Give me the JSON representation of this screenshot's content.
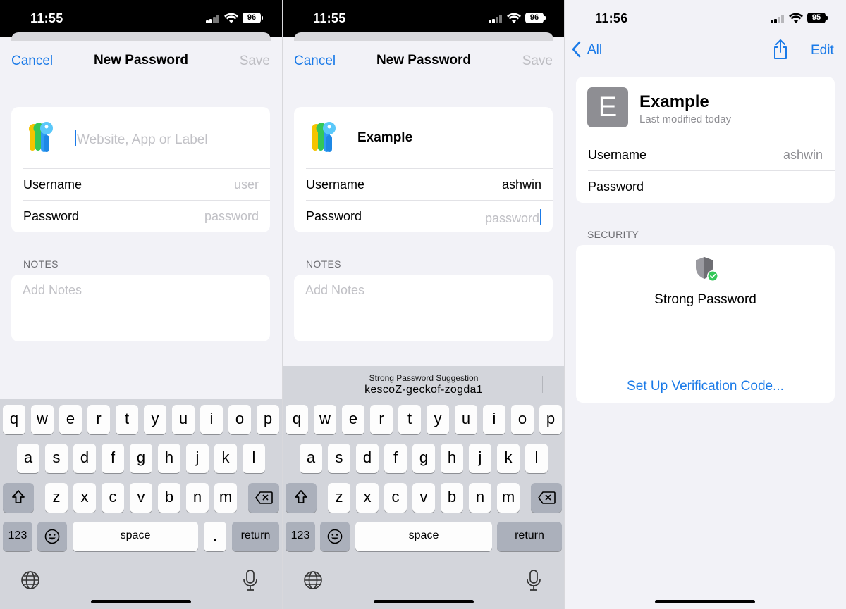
{
  "colors": {
    "accent": "#1a7ae8",
    "placeholder": "#c1c1c6",
    "keyboard_bg": "#d3d5db",
    "success": "#34c759"
  },
  "screens": [
    {
      "status": {
        "time": "11:55",
        "battery": "96"
      },
      "nav": {
        "cancel": "Cancel",
        "title": "New Password",
        "save": "Save"
      },
      "form": {
        "site_placeholder": "Website, App or Label",
        "site_value": "",
        "username_label": "Username",
        "username_value": "user",
        "password_label": "Password",
        "password_value": "password"
      },
      "notes": {
        "label": "NOTES",
        "placeholder": "Add Notes"
      },
      "keyboard": {
        "row1": [
          "q",
          "w",
          "e",
          "r",
          "t",
          "y",
          "u",
          "i",
          "o",
          "p"
        ],
        "row2": [
          "a",
          "s",
          "d",
          "f",
          "g",
          "h",
          "j",
          "k",
          "l"
        ],
        "row3": [
          "z",
          "x",
          "c",
          "v",
          "b",
          "n",
          "m"
        ],
        "numbers": "123",
        "space": "space",
        "period": ".",
        "return": "return"
      }
    },
    {
      "status": {
        "time": "11:55",
        "battery": "96"
      },
      "nav": {
        "cancel": "Cancel",
        "title": "New Password",
        "save": "Save"
      },
      "form": {
        "site_value": "Example",
        "username_label": "Username",
        "username_value": "ashwin",
        "password_label": "Password",
        "password_placeholder": "password"
      },
      "notes": {
        "label": "NOTES",
        "placeholder": "Add Notes"
      },
      "suggestion": {
        "title": "Strong Password Suggestion",
        "password": "kescoZ-geckof-zogda1"
      },
      "keyboard": {
        "row1": [
          "q",
          "w",
          "e",
          "r",
          "t",
          "y",
          "u",
          "i",
          "o",
          "p"
        ],
        "row2": [
          "a",
          "s",
          "d",
          "f",
          "g",
          "h",
          "j",
          "k",
          "l"
        ],
        "row3": [
          "z",
          "x",
          "c",
          "v",
          "b",
          "n",
          "m"
        ],
        "numbers": "123",
        "space": "space",
        "return": "return"
      }
    },
    {
      "status": {
        "time": "11:56",
        "battery": "95"
      },
      "nav": {
        "back": "All",
        "edit": "Edit"
      },
      "detail": {
        "avatar_letter": "E",
        "title": "Example",
        "subtitle": "Last modified today",
        "username_label": "Username",
        "username_value": "ashwin",
        "password_label": "Password"
      },
      "security": {
        "label": "SECURITY",
        "status": "Strong Password",
        "action": "Set Up Verification Code..."
      }
    }
  ]
}
